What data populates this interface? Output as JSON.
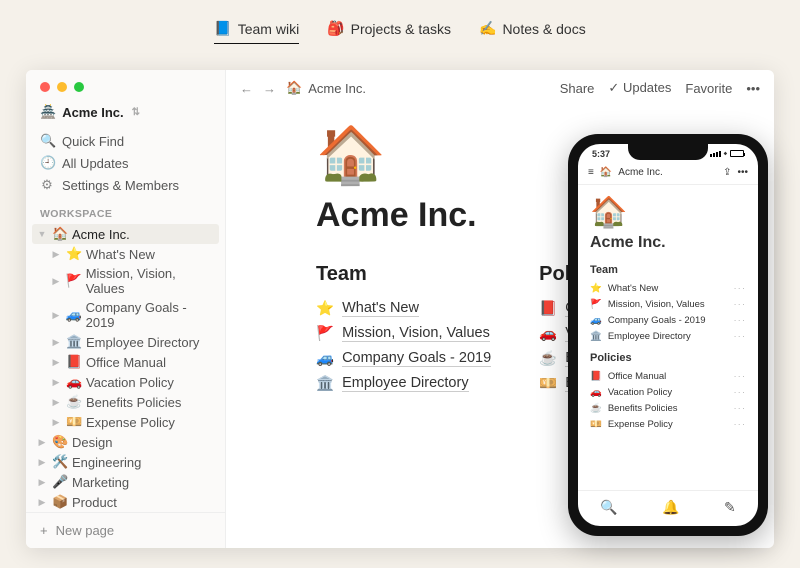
{
  "tabs": [
    {
      "emoji": "📘",
      "label": "Team wiki",
      "active": true
    },
    {
      "emoji": "🎒",
      "label": "Projects & tasks",
      "active": false
    },
    {
      "emoji": "✍️",
      "label": "Notes & docs",
      "active": false
    }
  ],
  "workspace": {
    "emoji": "🏯",
    "name": "Acme Inc."
  },
  "sidebar_nav": [
    {
      "icon": "🔍",
      "label": "Quick Find"
    },
    {
      "icon": "🕘",
      "label": "All Updates"
    },
    {
      "icon": "⚙",
      "label": "Settings & Members"
    }
  ],
  "sidebar_section": "WORKSPACE",
  "tree": {
    "root": {
      "emoji": "🏠",
      "label": "Acme Inc."
    },
    "children": [
      {
        "emoji": "⭐",
        "label": "What's New"
      },
      {
        "emoji": "🚩",
        "label": "Mission, Vision, Values"
      },
      {
        "emoji": "🚙",
        "label": "Company Goals - 2019"
      },
      {
        "emoji": "🏛️",
        "label": "Employee Directory"
      },
      {
        "emoji": "📕",
        "label": "Office Manual"
      },
      {
        "emoji": "🚗",
        "label": "Vacation Policy"
      },
      {
        "emoji": "☕",
        "label": "Benefits Policies"
      },
      {
        "emoji": "💴",
        "label": "Expense Policy"
      }
    ],
    "siblings": [
      {
        "emoji": "🎨",
        "label": "Design"
      },
      {
        "emoji": "🛠️",
        "label": "Engineering"
      },
      {
        "emoji": "🎤",
        "label": "Marketing"
      },
      {
        "emoji": "📦",
        "label": "Product"
      }
    ]
  },
  "new_page": "New page",
  "topbar": {
    "breadcrumb_emoji": "🏠",
    "breadcrumb": "Acme Inc.",
    "share": "Share",
    "updates": "Updates",
    "favorite": "Favorite"
  },
  "page": {
    "icon": "🏠",
    "title": "Acme Inc.",
    "columns": [
      {
        "heading": "Team",
        "links": [
          {
            "emoji": "⭐",
            "label": "What's New"
          },
          {
            "emoji": "🚩",
            "label": "Mission, Vision, Values"
          },
          {
            "emoji": "🚙",
            "label": "Company Goals - 2019"
          },
          {
            "emoji": "🏛️",
            "label": "Employee Directory"
          }
        ]
      },
      {
        "heading": "Policies",
        "links": [
          {
            "emoji": "📕",
            "label": "Office Manual"
          },
          {
            "emoji": "🚗",
            "label": "Vacation Policy"
          },
          {
            "emoji": "☕",
            "label": "Benefits Policies"
          },
          {
            "emoji": "💴",
            "label": "Expense Policy"
          }
        ]
      }
    ]
  },
  "phone": {
    "time": "5:37",
    "breadcrumb_emoji": "🏠",
    "breadcrumb": "Acme Inc.",
    "icon": "🏠",
    "title": "Acme Inc.",
    "sections": [
      {
        "heading": "Team",
        "links": [
          {
            "emoji": "⭐",
            "label": "What's New"
          },
          {
            "emoji": "🚩",
            "label": "Mission, Vision, Values"
          },
          {
            "emoji": "🚙",
            "label": "Company Goals - 2019"
          },
          {
            "emoji": "🏛️",
            "label": "Employee Directory"
          }
        ]
      },
      {
        "heading": "Policies",
        "links": [
          {
            "emoji": "📕",
            "label": "Office Manual"
          },
          {
            "emoji": "🚗",
            "label": "Vacation Policy"
          },
          {
            "emoji": "☕",
            "label": "Benefits Policies"
          },
          {
            "emoji": "💴",
            "label": "Expense Policy"
          }
        ]
      }
    ]
  }
}
